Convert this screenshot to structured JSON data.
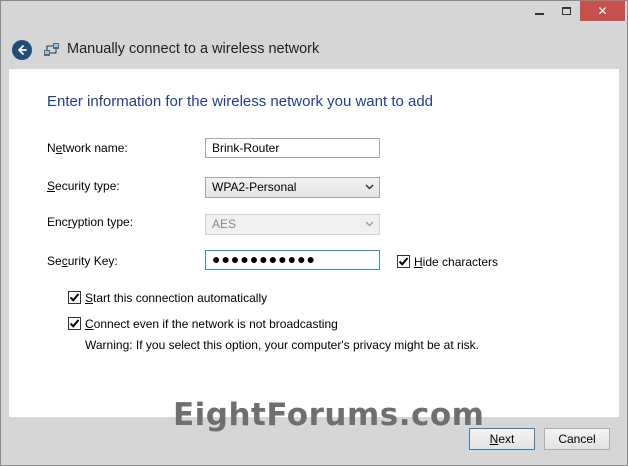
{
  "window": {
    "title": "Manually connect to a wireless network",
    "caption": {
      "close_glyph": "✕"
    }
  },
  "main": {
    "heading": "Enter information for the wireless network you want to add",
    "network_name": {
      "label_pre": "N",
      "label_ul": "e",
      "label_post": "twork name:",
      "value": "Brink-Router"
    },
    "security_type": {
      "label_pre": "",
      "label_ul": "S",
      "label_post": "ecurity type:",
      "value": "WPA2-Personal"
    },
    "encryption_type": {
      "label_pre": "Enc",
      "label_ul": "r",
      "label_post": "yption type:",
      "value": "AES"
    },
    "security_key": {
      "label_pre": "Se",
      "label_ul": "c",
      "label_post": "urity Key:",
      "value": "●●●●●●●●●●●"
    },
    "hide_characters": {
      "label_ul": "H",
      "label_post": "ide characters",
      "checked": true
    },
    "start_auto": {
      "label_ul": "S",
      "label_post": "tart this connection automatically",
      "checked": true
    },
    "connect_broadcast": {
      "label_ul": "C",
      "label_post": "onnect even if the network is not broadcasting",
      "checked": true
    },
    "warning": "Warning: If you select this option, your computer's privacy might be at risk."
  },
  "watermark": "EightForums.com",
  "footer": {
    "next": {
      "label_ul": "N",
      "label_post": "ext"
    },
    "cancel": "Cancel"
  },
  "colors": {
    "heading": "#1e3f91",
    "close_button": "#c7504c",
    "accent": "#3b88d6"
  },
  "icons": {
    "back": "back-arrow-icon",
    "network": "network-adapter-icon",
    "check": "check-icon",
    "chevron": "chevron-down-icon"
  }
}
